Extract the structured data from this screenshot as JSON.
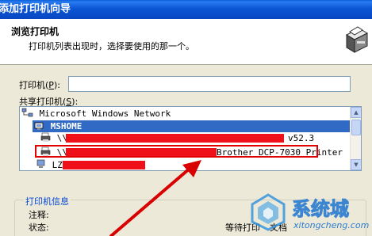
{
  "window": {
    "title": "添加打印机向导"
  },
  "header": {
    "title": "浏览打印机",
    "subtitle": "打印机列表出现时，选择要使用的那一个。",
    "icon": "printer-icon"
  },
  "printer_field": {
    "label": "打印机",
    "accel": "P",
    "value": ""
  },
  "shared_list": {
    "label": "共享打印机",
    "accel": "S",
    "items": [
      {
        "text": "Microsoft Windows Network",
        "icon": "network-icon"
      },
      {
        "text": "MSHOME",
        "icon": "workgroup-icon",
        "selected": true
      },
      {
        "prefix": "\\\\",
        "suffix": "v52.3",
        "icon": "printer-icon"
      },
      {
        "prefix": "\\\\",
        "suffix": "Brother DCP-7030 Printer",
        "icon": "printer-icon",
        "highlighted": true
      },
      {
        "prefix": "LZ",
        "icon": "computer-icon"
      }
    ]
  },
  "printer_info": {
    "title": "打印机信息",
    "comment_label": "注释:",
    "status_label": "状态:",
    "status_value": "等待打印",
    "docs_fragment": "文档"
  },
  "watermark": {
    "brand": "系统城",
    "url": "xitongcheng.com"
  },
  "colors": {
    "selection": "#316ac5",
    "redaction": "#f0101a",
    "annotation": "#e00000",
    "titlebar": "#0b56d4"
  }
}
